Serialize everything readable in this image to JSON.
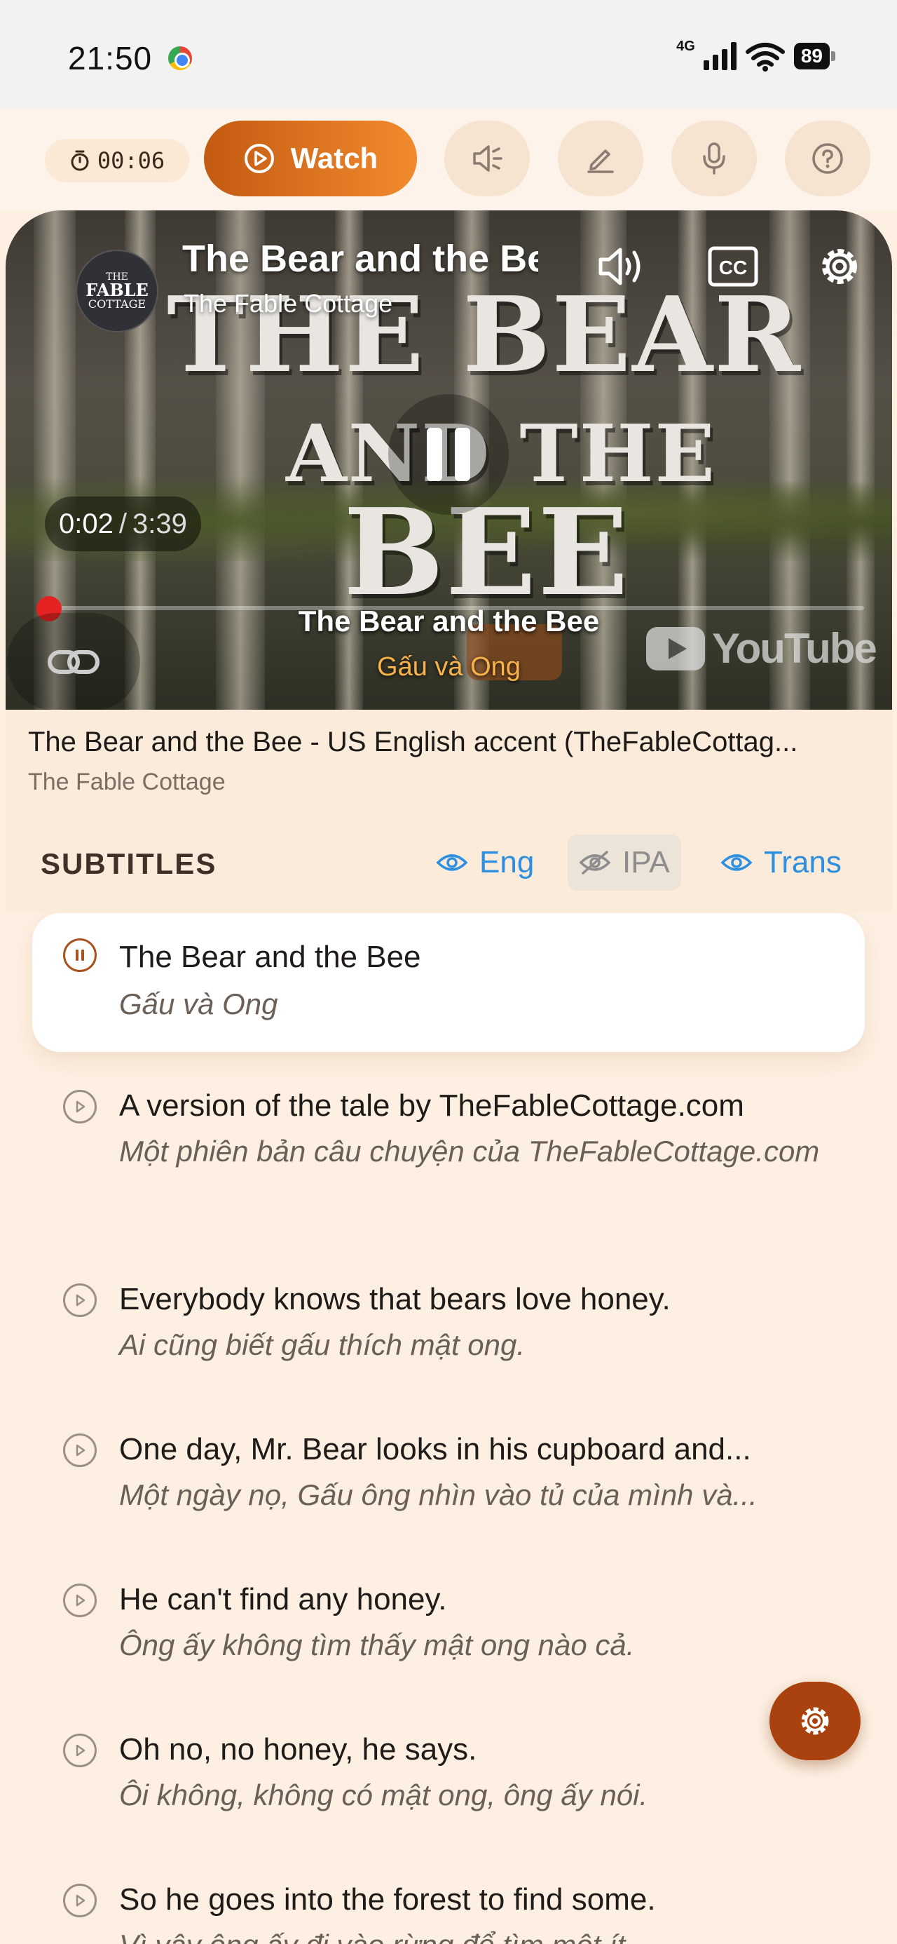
{
  "status_bar": {
    "time": "21:50",
    "network": "4G",
    "battery": "89"
  },
  "toolbar": {
    "timer": "00:06",
    "watch_label": "Watch"
  },
  "video": {
    "title": "The Bear and the Bee",
    "channel": "The Fable Cottage",
    "avatar_text": [
      "THE",
      "FABLE",
      "COTTAGE"
    ],
    "artwork_lines": [
      "THE BEAR",
      "AND THE",
      "BEE"
    ],
    "current_time": "0:02",
    "duration": "3:39",
    "progress": 0.01,
    "overlay_subtitle": "The Bear and the Bee",
    "overlay_translation": "Gấu và Ong",
    "platform": "YouTube"
  },
  "info": {
    "title": "The Bear and the Bee - US English accent (TheFableCottag...",
    "channel": "The Fable Cottage"
  },
  "subtitles": {
    "label": "SUBTITLES",
    "toggles": [
      {
        "label": "Eng",
        "on": true
      },
      {
        "label": "IPA",
        "on": false
      },
      {
        "label": "Trans",
        "on": true
      }
    ],
    "items": [
      {
        "en": "The Bear and the Bee",
        "vi": "Gấu và Ong",
        "active": true
      },
      {
        "en": "A version of the tale by TheFableCottage.com",
        "vi": "Một phiên bản câu chuyện của TheFableCottage.com",
        "active": false
      },
      {
        "en": "Everybody knows that bears love honey.",
        "vi": "Ai cũng biết gấu thích mật ong.",
        "active": false
      },
      {
        "en": "One day, Mr. Bear looks in his cupboard and...",
        "vi": "Một ngày nọ, Gấu ông nhìn vào tủ của mình và...",
        "active": false
      },
      {
        "en": "He can't find any honey.",
        "vi": "Ông ấy không tìm thấy mật ong nào cả.",
        "active": false
      },
      {
        "en": "Oh no, no honey, he says.",
        "vi": "Ôi không, không có mật ong, ông ấy nói.",
        "active": false
      },
      {
        "en": "So he goes into the forest to find some.",
        "vi": "Vì vậy ông ấy đi vào rừng để tìm một ít.",
        "active": false
      }
    ]
  },
  "colors": {
    "accent": "#c35a12",
    "toggle_on": "#2d8fe0",
    "background": "#fdf0e2"
  }
}
